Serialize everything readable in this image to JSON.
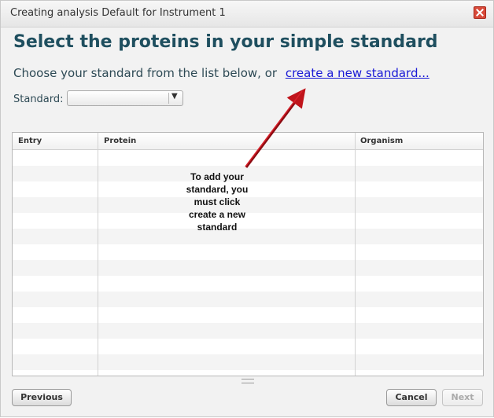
{
  "window": {
    "title": "Creating analysis Default for Instrument 1"
  },
  "page": {
    "heading": "Select the proteins in your simple standard",
    "subtitle_text": "Choose your standard from the list below, or",
    "subtitle_link": "create a new standard..."
  },
  "standard": {
    "label": "Standard:",
    "selected_value": ""
  },
  "table": {
    "columns": [
      "Entry",
      "Protein",
      "Organism"
    ],
    "rows": []
  },
  "annotation": {
    "lines": [
      "To add your",
      "standard, you",
      "must click",
      "create a new",
      "standard"
    ]
  },
  "buttons": {
    "previous": "Previous",
    "cancel": "Cancel",
    "next": "Next"
  },
  "colors": {
    "heading": "#1f4f5f",
    "link": "#1a1ad6",
    "arrow": "#c0141b",
    "close_button": "#d84a3a"
  }
}
